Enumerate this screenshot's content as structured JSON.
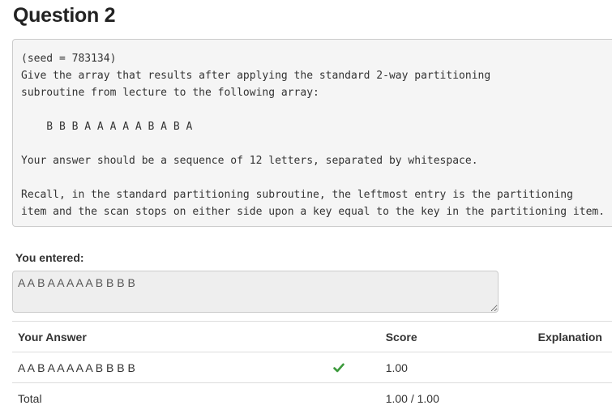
{
  "question": {
    "title": "Question 2",
    "prompt_lines": [
      "(seed = 783134)",
      "Give the array that results after applying the standard 2-way partitioning",
      "subroutine from lecture to the following array:",
      "",
      "    B B B A A A A A B A B A",
      "",
      "Your answer should be a sequence of 12 letters, separated by whitespace.",
      "",
      "Recall, in the standard partitioning subroutine, the leftmost entry is the partitioning",
      "item and the scan stops on either side upon a key equal to the key in the partitioning item."
    ]
  },
  "submission": {
    "label": "You entered:",
    "value": "A A B A A A A A B B B B"
  },
  "results": {
    "headers": {
      "answer": "Your Answer",
      "score": "Score",
      "explanation": "Explanation"
    },
    "rows": [
      {
        "answer": "A A B A A A A A B B B B",
        "correct": true,
        "score": "1.00",
        "explanation": ""
      }
    ],
    "total": {
      "label": "Total",
      "score": "1.00 / 1.00"
    }
  },
  "colors": {
    "check": "#3c9a3c",
    "box_background": "#f5f5f5",
    "border": "#cccccc"
  },
  "icons": {
    "correct": "check-icon"
  }
}
